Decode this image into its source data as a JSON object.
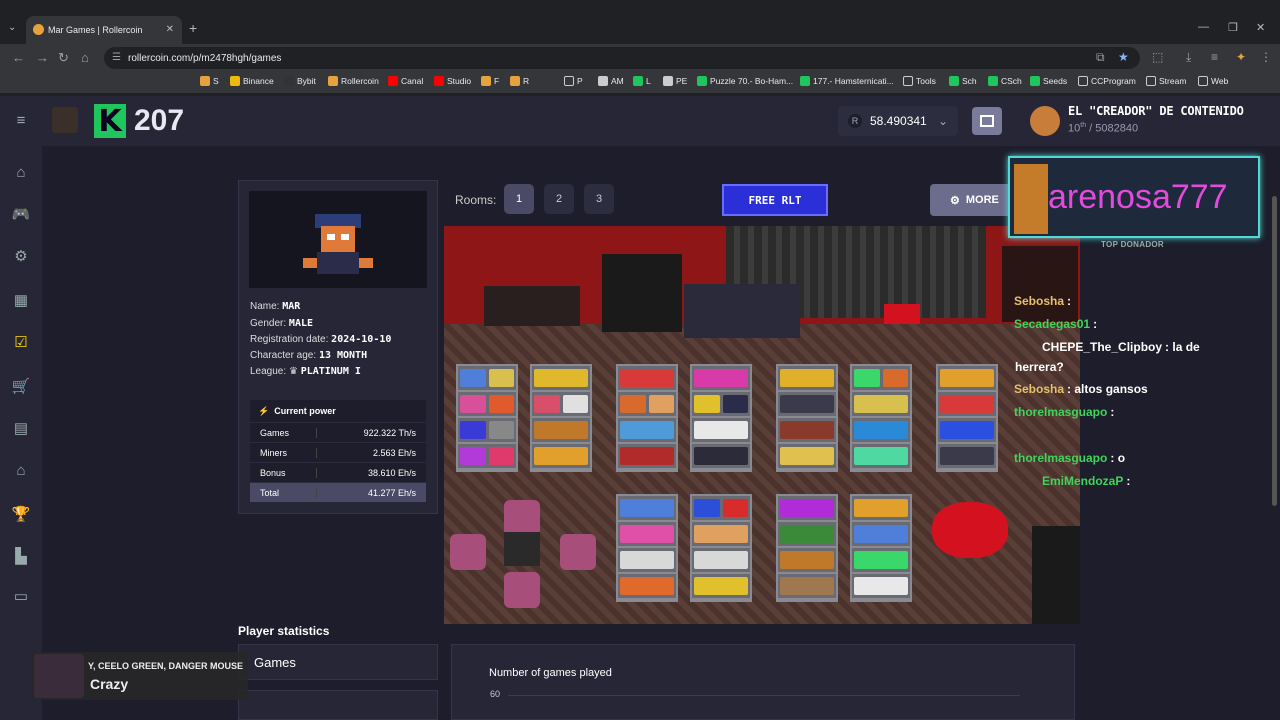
{
  "browser": {
    "tab_title": "Mar Games | Rollercoin",
    "url": "rollercoin.com/p/m2478hgh/games",
    "bookmarks": [
      "S",
      "Binance",
      "Bybit",
      "Rollercoin",
      "Canal",
      "Studio",
      "F",
      "R",
      "P",
      "AM",
      "L",
      "PE",
      "Puzzle 70.- Bo-Ham...",
      "177.- Hamsternicati...",
      "Tools",
      "Sch",
      "CSch",
      "Seeds",
      "CCProgram",
      "Stream",
      "Web"
    ]
  },
  "header": {
    "level": "207",
    "balance": "58.490341",
    "balance_currency": "R",
    "creator_title": "EL \"CREADOR\" DE CONTENIDO",
    "creator_rank_num": "10",
    "creator_rank_sup": "th",
    "creator_rank_total": "/ 5082840"
  },
  "player": {
    "name_label": "Name:",
    "name": "MAR",
    "gender_label": "Gender:",
    "gender": "MALE",
    "reg_label": "Registration date:",
    "reg": "2024-10-10",
    "age_label": "Character age:",
    "age": "13 MONTH",
    "league_label": "League:",
    "league": "PLATINUM I",
    "power_title": "Current power",
    "power": [
      {
        "label": "Games",
        "value": "922.322 Th/s"
      },
      {
        "label": "Miners",
        "value": "2.563 Eh/s"
      },
      {
        "label": "Bonus",
        "value": "38.610 Eh/s"
      },
      {
        "label": "Total",
        "value": "41.277 Eh/s"
      }
    ]
  },
  "rooms": {
    "label": "Rooms:",
    "buttons": [
      "1",
      "2",
      "3"
    ],
    "free_rlt": "FREE RLT",
    "more": "MORE"
  },
  "donor": {
    "name": "arenosa777",
    "tag": "TOP DONADOR"
  },
  "chat": [
    {
      "user": "Sebosha",
      "msg": ":",
      "color": "#e6c06a"
    },
    {
      "user": "Secadegas01",
      "msg": ":",
      "color": "#3ed65a"
    },
    {
      "user": "CHEPE_The_Clipboy",
      "msg": ": la de",
      "color": "#ffffff"
    },
    {
      "user": "",
      "msg": "herrera?",
      "color": "#ffffff"
    },
    {
      "user": "Sebosha",
      "msg": ": altos gansos",
      "color": "#e6c06a"
    },
    {
      "user": "thorelmasguapo",
      "msg": ":",
      "color": "#3ed65a"
    },
    {
      "user": "thorelmasguapo",
      "msg": ": o",
      "color": "#3ed65a"
    },
    {
      "user": "EmiMendozaP",
      "msg": ":",
      "color": "#3ed65a"
    }
  ],
  "stats": {
    "title": "Player statistics",
    "games_tab": "Games",
    "chart_title": "Number of games played",
    "chart_y_tick": "60"
  },
  "music": {
    "artist": "Y, CEELO GREEN, DANGER MOUSE",
    "title": "Crazy"
  }
}
